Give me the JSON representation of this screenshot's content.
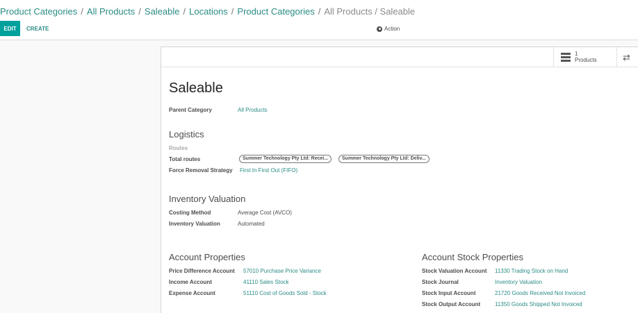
{
  "breadcrumb": {
    "links": [
      "Product Categories",
      "All Products",
      "Saleable",
      "Locations",
      "Product Categories"
    ],
    "active": "All Products / Saleable"
  },
  "toolbar": {
    "edit_label": "EDIT",
    "create_label": "CREATE",
    "action_label": "Action"
  },
  "stat_button": {
    "count": "1",
    "label": "Products"
  },
  "record": {
    "name": "Saleable",
    "parent_category_label": "Parent Category",
    "parent_category_value": "All Products"
  },
  "logistics": {
    "heading": "Logistics",
    "routes_label": "Routes",
    "total_routes_label": "Total routes",
    "routes": [
      "Summer Technology Pty Ltd: Recei...",
      "Summer Technology Pty Ltd: Deliv..."
    ],
    "removal_label": "Force Removal Strategy",
    "removal_value": "First In First Out (FIFO)"
  },
  "inventory_valuation": {
    "heading": "Inventory Valuation",
    "costing_label": "Costing Method",
    "costing_value": "Average Cost (AVCO)",
    "valuation_label": "Inventory Valuation",
    "valuation_value": "Automated"
  },
  "account_properties": {
    "heading": "Account Properties",
    "fields": [
      {
        "label": "Price Difference Account",
        "value": "57010 Purchase Price Variance"
      },
      {
        "label": "Income Account",
        "value": "41110 Sales Stock"
      },
      {
        "label": "Expense Account",
        "value": "51110 Cost of Goods Sold - Stock"
      }
    ]
  },
  "account_stock_properties": {
    "heading": "Account Stock Properties",
    "fields": [
      {
        "label": "Stock Valuation Account",
        "value": "11330 Trading Stock on Hand"
      },
      {
        "label": "Stock Journal",
        "value": "Inventory Valuation"
      },
      {
        "label": "Stock Input Account",
        "value": "21720 Goods Received Not Invoiced"
      },
      {
        "label": "Stock Output Account",
        "value": "11350 Goods Shipped Not Invoiced"
      }
    ]
  },
  "colors": {
    "accent": "#00a09d",
    "link": "#2a8c85",
    "brand_bar": "#7c7bad"
  }
}
